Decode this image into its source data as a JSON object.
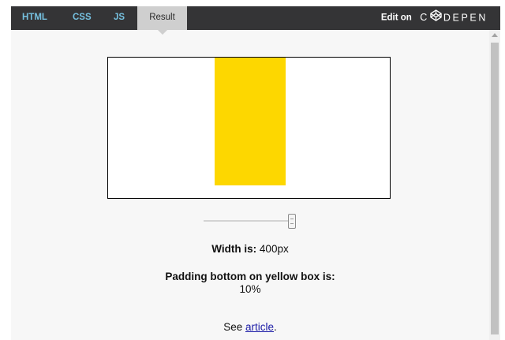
{
  "tabs": [
    {
      "label": "HTML"
    },
    {
      "label": "CSS"
    },
    {
      "label": "JS"
    },
    {
      "label": "Result",
      "active": true
    }
  ],
  "edit_on": {
    "label": "Edit on",
    "brand_c": "C",
    "brand_rest": "DEPEN",
    "brand_icon": "codepen-logo-icon"
  },
  "colors": {
    "topbar": "#343436",
    "tab_link": "#76c1e0",
    "active_tab": "#cfcfcf",
    "yellow_box": "#fdd700",
    "link": "#1a1aa6"
  },
  "slider": {
    "value_label": "400px"
  },
  "width_info": {
    "label": "Width is:",
    "value": "400px"
  },
  "padding_info": {
    "label": "Padding bottom on yellow box is:",
    "value": "10%"
  },
  "see_article": {
    "prefix": "See",
    "link_text": "article",
    "suffix": "."
  }
}
